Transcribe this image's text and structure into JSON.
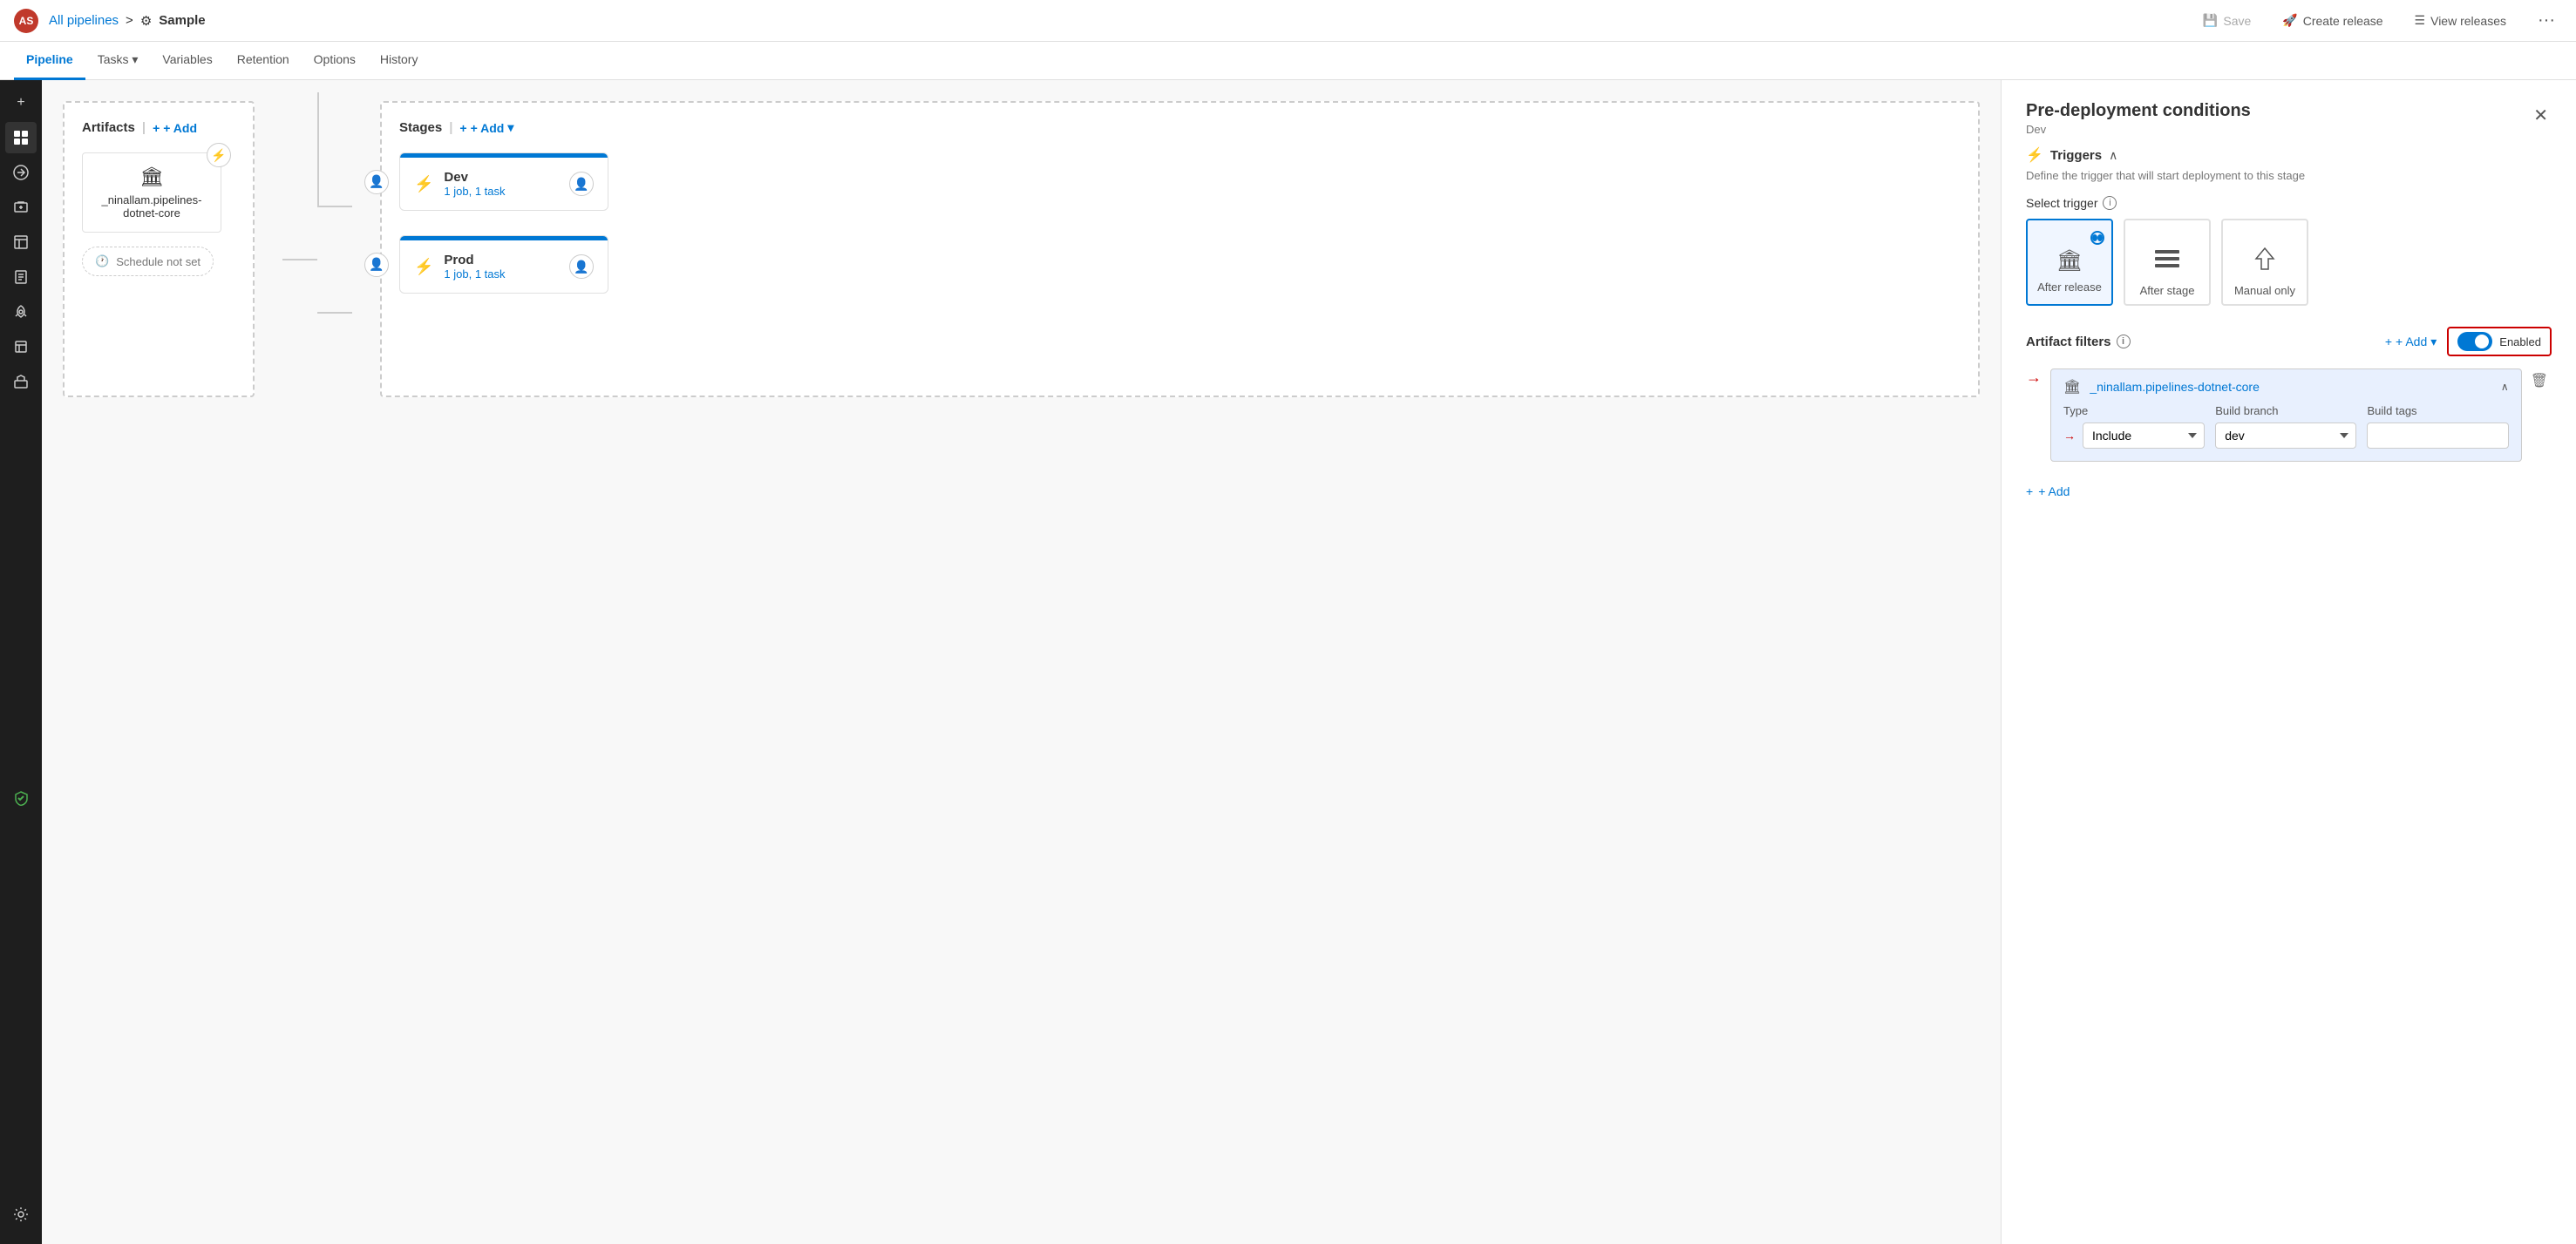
{
  "app": {
    "avatar_initials": "AS",
    "breadcrumb_link": "All pipelines",
    "breadcrumb_sep": ">",
    "pipeline_name": "Sample"
  },
  "topbar": {
    "save_label": "Save",
    "create_release_label": "Create release",
    "view_releases_label": "View releases",
    "more_icon": "···"
  },
  "navtabs": [
    {
      "id": "pipeline",
      "label": "Pipeline",
      "active": true
    },
    {
      "id": "tasks",
      "label": "Tasks",
      "has_dropdown": true
    },
    {
      "id": "variables",
      "label": "Variables"
    },
    {
      "id": "retention",
      "label": "Retention"
    },
    {
      "id": "options",
      "label": "Options"
    },
    {
      "id": "history",
      "label": "History"
    }
  ],
  "sidebar_icons": [
    {
      "id": "add",
      "symbol": "+",
      "title": "Add"
    },
    {
      "id": "dashboard",
      "symbol": "⊞",
      "title": "Dashboard"
    },
    {
      "id": "pipeline",
      "symbol": "⚙",
      "title": "Pipeline",
      "active": true
    },
    {
      "id": "deploy",
      "symbol": "↓",
      "title": "Deploy"
    },
    {
      "id": "boards",
      "symbol": "▦",
      "title": "Boards"
    },
    {
      "id": "repos",
      "symbol": "📁",
      "title": "Repos"
    },
    {
      "id": "test",
      "symbol": "🧪",
      "title": "Test"
    },
    {
      "id": "artifacts",
      "symbol": "📦",
      "title": "Artifacts"
    },
    {
      "id": "extensions",
      "symbol": "🔌",
      "title": "Extensions"
    },
    {
      "id": "security",
      "symbol": "🛡",
      "title": "Security",
      "green": true
    },
    {
      "id": "settings",
      "symbol": "⚙",
      "title": "Settings",
      "bottom": true
    }
  ],
  "canvas": {
    "artifacts_section": {
      "title": "Artifacts",
      "add_label": "+ Add",
      "artifact": {
        "name": "_ninallam.pipelines-dotnet-core",
        "icon": "🏛"
      },
      "schedule": {
        "label": "Schedule not set"
      }
    },
    "stages_section": {
      "title": "Stages",
      "add_label": "+ Add",
      "stages": [
        {
          "id": "dev",
          "name": "Dev",
          "tasks": "1 job, 1 task"
        },
        {
          "id": "prod",
          "name": "Prod",
          "tasks": "1 job, 1 task"
        }
      ]
    }
  },
  "right_panel": {
    "title": "Pre-deployment conditions",
    "subtitle": "Dev",
    "triggers": {
      "section_title": "Triggers",
      "description": "Define the trigger that will start deployment to this stage",
      "select_trigger_label": "Select trigger",
      "options": [
        {
          "id": "after_release",
          "label": "After release",
          "icon": "🏛",
          "selected": true
        },
        {
          "id": "after_stage",
          "label": "After stage",
          "icon": "≡",
          "selected": false
        },
        {
          "id": "manual_only",
          "label": "Manual only",
          "icon": "⚡",
          "selected": false
        }
      ]
    },
    "artifact_filters": {
      "section_title": "Artifact filters",
      "toggle_label": "Enabled",
      "toggle_enabled": true,
      "add_label": "+ Add",
      "items": [
        {
          "name": "_ninallam.pipelines-dotnet-core",
          "icon": "🏛",
          "expanded": true,
          "type_label": "Type",
          "type_value": "Include",
          "branch_label": "Build branch",
          "branch_value": "dev",
          "tags_label": "Build tags",
          "tags_value": ""
        }
      ],
      "add_filter_label": "+ Add"
    }
  }
}
